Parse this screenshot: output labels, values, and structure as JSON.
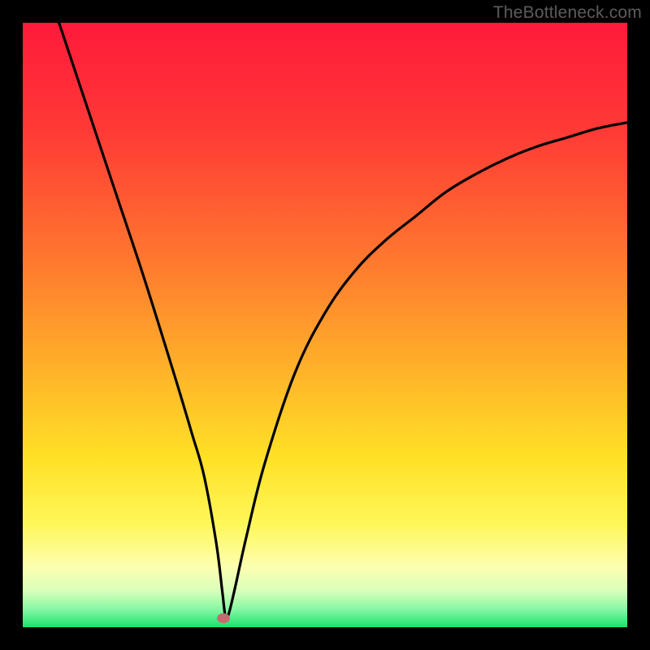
{
  "watermark": "TheBottleneck.com",
  "chart_data": {
    "type": "line",
    "title": "",
    "xlabel": "",
    "ylabel": "",
    "xlim": [
      0,
      100
    ],
    "ylim": [
      0,
      100
    ],
    "grid": false,
    "legend": false,
    "annotations": [],
    "series": [
      {
        "name": "bottleneck-curve",
        "x": [
          6,
          10,
          15,
          20,
          25,
          28,
          30,
          32,
          33,
          33.5,
          34,
          35,
          37,
          40,
          45,
          50,
          55,
          60,
          65,
          70,
          75,
          80,
          85,
          90,
          95,
          100
        ],
        "y": [
          100,
          88,
          73,
          58,
          42,
          32,
          25,
          14,
          6,
          2,
          2,
          6,
          15,
          27,
          42,
          52,
          59,
          64,
          68,
          72,
          75,
          77.5,
          79.5,
          81,
          82.5,
          83.5
        ]
      }
    ],
    "minimum_marker": {
      "x": 33.2,
      "y": 1.5,
      "color": "#c76a6e"
    },
    "background_gradient_stops": [
      {
        "pct": 0,
        "color": "#ff1a3b"
      },
      {
        "pct": 18,
        "color": "#ff3a36"
      },
      {
        "pct": 40,
        "color": "#ff7a2e"
      },
      {
        "pct": 58,
        "color": "#ffb429"
      },
      {
        "pct": 72,
        "color": "#ffe126"
      },
      {
        "pct": 83,
        "color": "#fff75a"
      },
      {
        "pct": 90,
        "color": "#fdffb0"
      },
      {
        "pct": 94,
        "color": "#d8ffbb"
      },
      {
        "pct": 97,
        "color": "#87f7a4"
      },
      {
        "pct": 100,
        "color": "#19e36e"
      }
    ]
  }
}
